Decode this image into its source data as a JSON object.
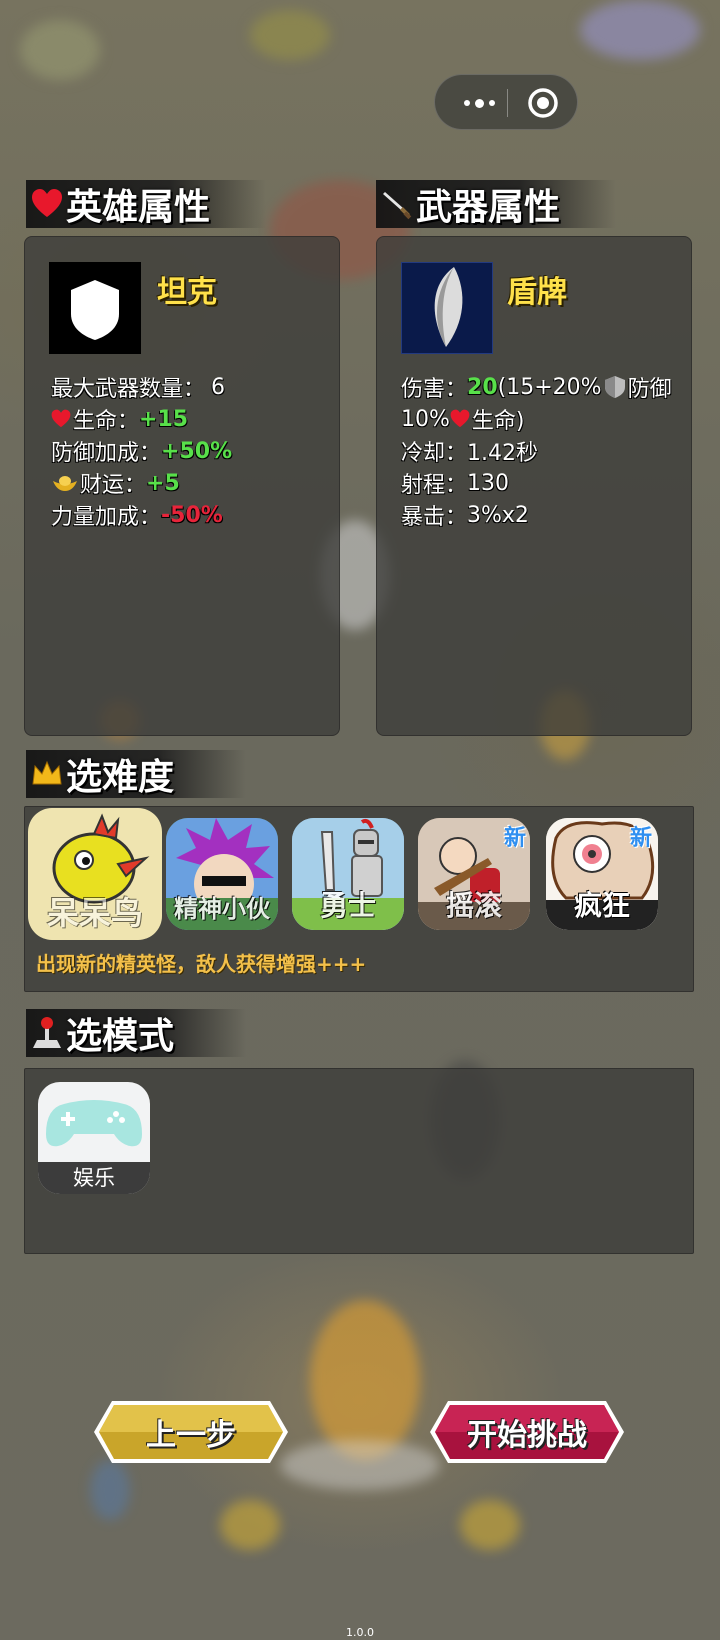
{
  "capsule": {
    "more_icon": "more-dots-icon",
    "close_icon": "target-close-icon"
  },
  "hero": {
    "section_title": "英雄属性",
    "icon": "heart-icon",
    "name": "坦克",
    "max_weapons_label": "最大武器数量：",
    "max_weapons_value": "6",
    "life_label": "生命：",
    "life_value": "+15",
    "defense_label": "防御加成：",
    "defense_value": "+50%",
    "luck_label": "财运：",
    "luck_value": "+5",
    "power_label": "力量加成：",
    "power_value": "-50%"
  },
  "weapon": {
    "section_title": "武器属性",
    "icon": "sword-icon",
    "name": "盾牌",
    "damage_label": "伤害：",
    "damage_value": "20",
    "damage_formula_a": "(15+20%",
    "damage_defense_label": "防御",
    "damage_formula_b": "10%",
    "damage_life_label": "生命)",
    "cooldown_label": "冷却：",
    "cooldown_value": "1.42秒",
    "range_label": "射程：",
    "range_value": "130",
    "crit_label": "暴击：",
    "crit_value": "3%x2"
  },
  "difficulty": {
    "section_title": "选难度",
    "icon": "crown-icon",
    "options": [
      {
        "label": "呆呆鸟",
        "is_new": false
      },
      {
        "label": "精神小伙",
        "is_new": false
      },
      {
        "label": "勇士",
        "is_new": false
      },
      {
        "label": "摇滚",
        "is_new": true,
        "new_tag": "新"
      },
      {
        "label": "疯狂",
        "is_new": true,
        "new_tag": "新"
      }
    ],
    "hint": "出现新的精英怪，敌人获得增强+++"
  },
  "mode": {
    "section_title": "选模式",
    "icon": "joystick-icon",
    "options": [
      {
        "label": "娱乐",
        "icon": "gamepad-icon"
      }
    ]
  },
  "buttons": {
    "prev": "上一步",
    "start": "开始挑战"
  },
  "version": "1.0.0",
  "colors": {
    "name_yellow": "#ffe14a",
    "positive_green": "#58e04a",
    "negative_red": "#e8243a",
    "hint_orange": "#f3c04a",
    "new_blue": "#2f8ff0"
  }
}
